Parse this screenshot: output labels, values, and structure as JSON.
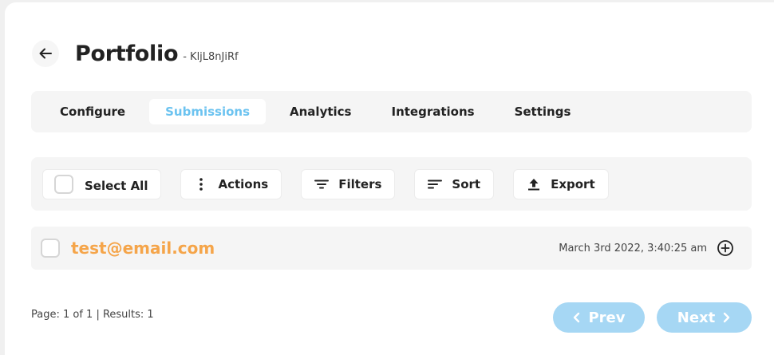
{
  "header": {
    "back_icon": "arrow-left-icon",
    "title": "Portfolio",
    "form_id": "- KljL8nJiRf"
  },
  "tabs": [
    {
      "label": "Configure",
      "active": false
    },
    {
      "label": "Submissions",
      "active": true
    },
    {
      "label": "Analytics",
      "active": false
    },
    {
      "label": "Integrations",
      "active": false
    },
    {
      "label": "Settings",
      "active": false
    }
  ],
  "toolbar": {
    "select_all_label": "Select All",
    "actions_label": "Actions",
    "filters_label": "Filters",
    "sort_label": "Sort",
    "export_label": "Export"
  },
  "submissions": [
    {
      "email": "test@email.com",
      "date": "March 3rd 2022, 3:40:25 am"
    }
  ],
  "pagination": {
    "info": "Page: 1 of 1 | Results: 1",
    "prev_label": "Prev",
    "next_label": "Next"
  },
  "colors": {
    "accent": "#6cc3f0",
    "email": "#f5a54a",
    "pager_button": "#a6d7f4",
    "panel": "#f5f5f5"
  }
}
